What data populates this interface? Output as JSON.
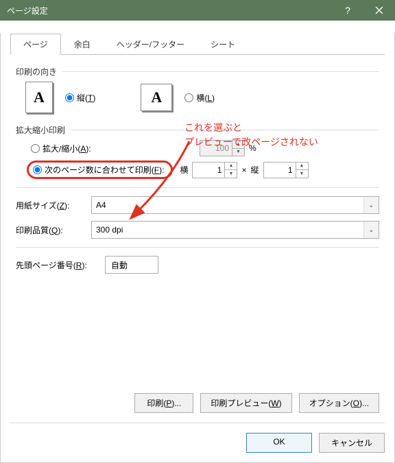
{
  "window": {
    "title": "ページ設定"
  },
  "tabs": {
    "page": "ページ",
    "margins": "余白",
    "header_footer": "ヘッダー/フッター",
    "sheet": "シート"
  },
  "orientation": {
    "group_label": "印刷の向き",
    "portrait_label": "縦(",
    "portrait_key": "T",
    "landscape_label": "横(",
    "landscape_key": "L",
    "close": ")"
  },
  "scaling": {
    "group_label": "拡大縮小印刷",
    "adjust_label": "拡大/縮小(",
    "adjust_key": "A",
    "adjust_close": "):",
    "adjust_value": "100",
    "percent": "%",
    "fit_label": "次のページ数に合わせて印刷(",
    "fit_key": "F",
    "fit_close": "):",
    "wide_label": "横",
    "wide_value": "1",
    "times": "×",
    "tall_label": "縦",
    "tall_value": "1"
  },
  "paper": {
    "size_label": "用紙サイズ(",
    "size_key": "Z",
    "size_close": "):",
    "size_value": "A4",
    "quality_label": "印刷品質(",
    "quality_key": "Q",
    "quality_close": "):",
    "quality_value": "300 dpi"
  },
  "firstpage": {
    "label": "先頭ページ番号(",
    "key": "R",
    "close": "):",
    "value": "自動"
  },
  "buttons": {
    "print": "印刷(",
    "print_key": "P",
    "print_close": ")...",
    "preview": "印刷プレビュー(",
    "preview_key": "W",
    "preview_close": ")",
    "options": "オプション(",
    "options_key": "O",
    "options_close": ")...",
    "ok": "OK",
    "cancel": "キャンセル"
  },
  "annotation": {
    "line1": "これを選ぶと",
    "line2": "プレビューで改ページされない"
  }
}
